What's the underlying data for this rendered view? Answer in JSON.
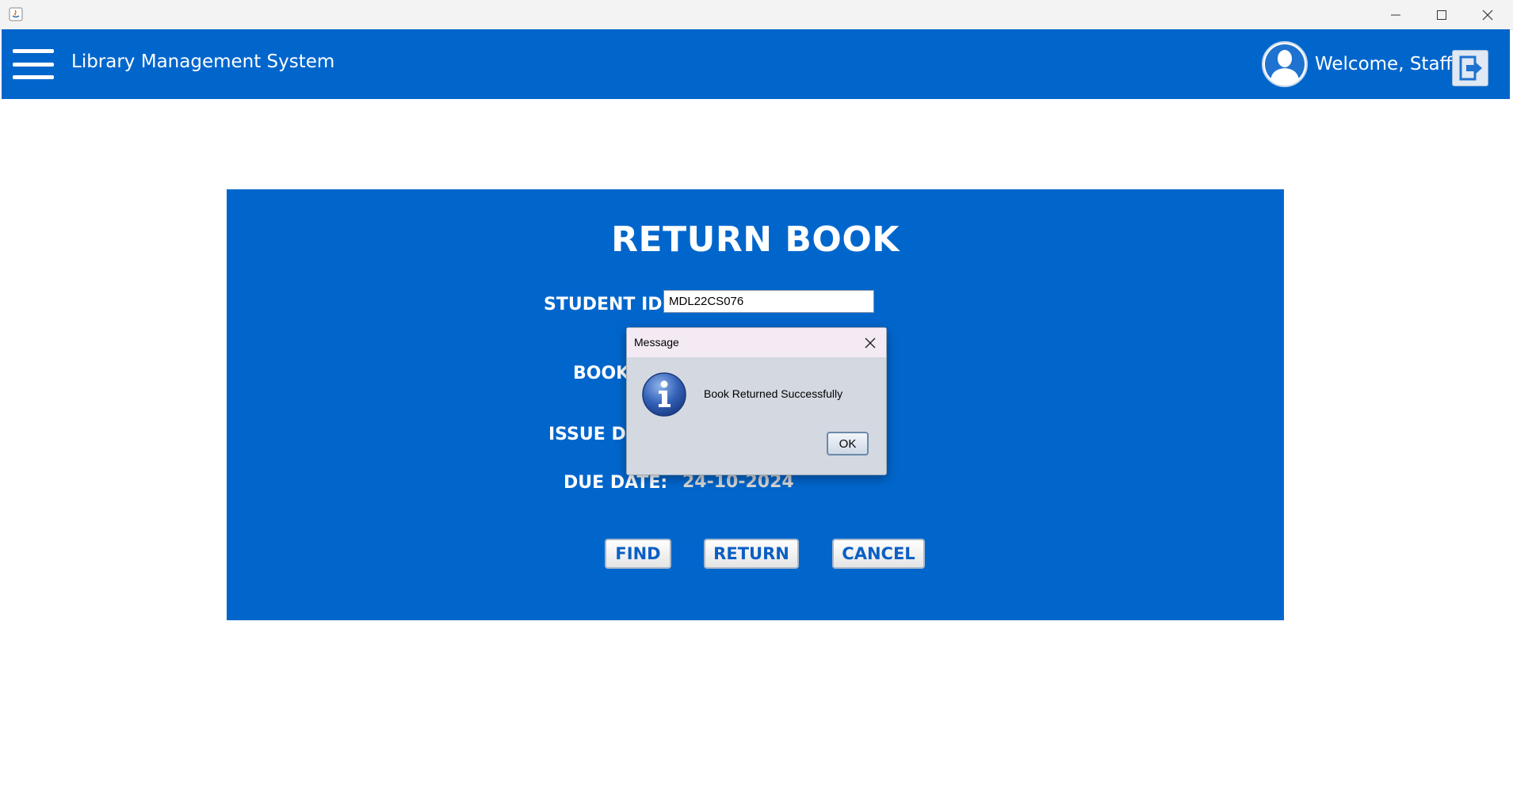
{
  "window": {
    "title": ""
  },
  "header": {
    "app_title": "Library Management System",
    "welcome": "Welcome, Staff!"
  },
  "panel": {
    "title": "RETURN BOOK",
    "student_id_label": "STUDENT ID:",
    "student_id_value": "MDL22CS076",
    "book_label_partial": "BOOK",
    "issue_date_label_partial": "ISSUE DA",
    "due_date_label": "DUE DATE:",
    "due_date_value": "24-10-2024",
    "buttons": {
      "find": "FIND",
      "return": "RETURN",
      "cancel": "CANCEL"
    }
  },
  "dialog": {
    "title": "Message",
    "message": "Book Returned Successfully",
    "ok_label": "OK"
  },
  "colors": {
    "primary": "#0066cc",
    "button_text": "#0b5fc4",
    "value_text": "#d6d6d6"
  },
  "icons": {
    "app": "java-icon",
    "menu": "hamburger-menu-icon",
    "user": "user-avatar-icon",
    "logout": "logout-icon",
    "info": "info-icon",
    "close": "close-icon"
  }
}
